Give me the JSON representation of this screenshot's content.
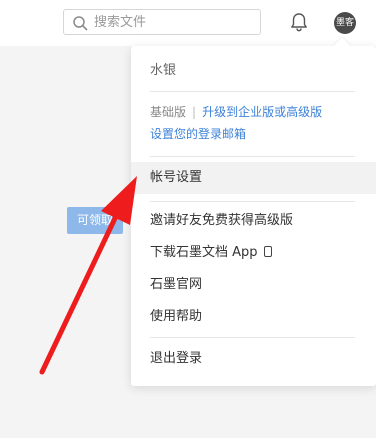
{
  "header": {
    "search_placeholder": "搜索文件",
    "avatar_text": "墨客"
  },
  "background": {
    "button_label": "可领取"
  },
  "menu": {
    "username": "水银",
    "plan": "基础版",
    "separator": "|",
    "upgrade_link": "升级到企业版或高级版",
    "email_link": "设置您的登录邮箱",
    "account_settings": "帐号设置",
    "invite": "邀请好友免费获得高级版",
    "download_app": "下载石墨文档 App",
    "website": "石墨官网",
    "help": "使用帮助",
    "logout": "退出登录"
  },
  "colors": {
    "link": "#3d82d9",
    "arrow": "#ee1c1c"
  },
  "icons": [
    "search-icon",
    "bell-icon",
    "phone-icon"
  ]
}
